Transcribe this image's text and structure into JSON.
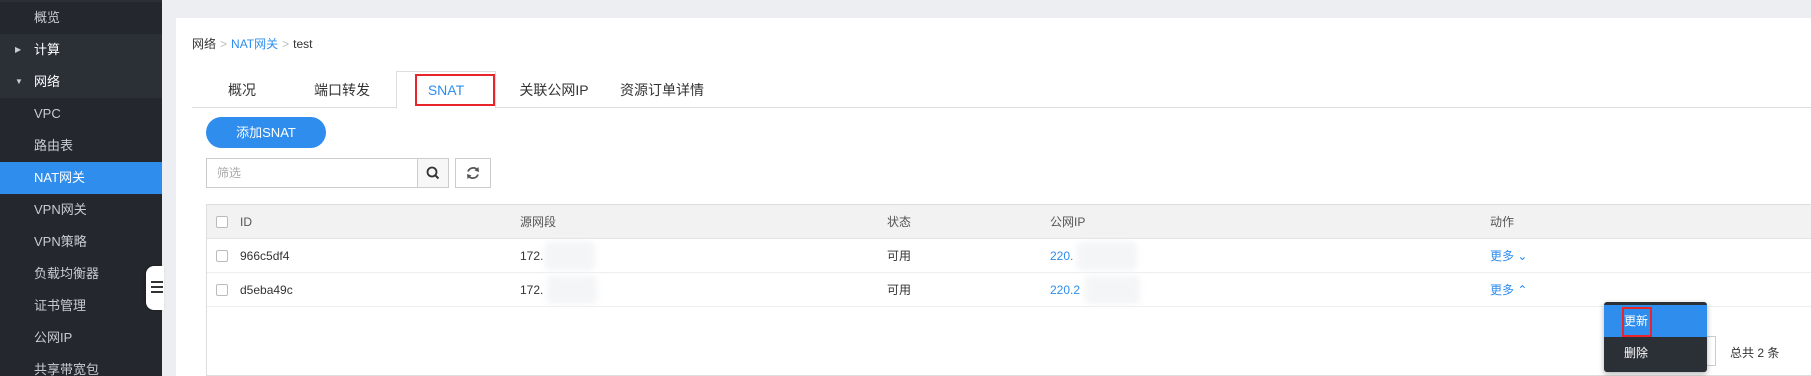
{
  "sidebar": {
    "items": [
      {
        "label": "概览"
      },
      {
        "label": "计算"
      },
      {
        "label": "网络"
      },
      {
        "label": "VPC"
      },
      {
        "label": "路由表"
      },
      {
        "label": "NAT网关"
      },
      {
        "label": "VPN网关"
      },
      {
        "label": "VPN策略"
      },
      {
        "label": "负载均衡器"
      },
      {
        "label": "证书管理"
      },
      {
        "label": "公网IP"
      },
      {
        "label": "共享带宽包"
      }
    ],
    "active": "NAT网关"
  },
  "breadcrumb": {
    "root": "网络",
    "sep1": ">",
    "parent": "NAT网关",
    "sep2": ">",
    "current": "test"
  },
  "tabs": [
    {
      "label": "概况"
    },
    {
      "label": "端口转发"
    },
    {
      "label": "SNAT"
    },
    {
      "label": "关联公网IP"
    },
    {
      "label": "资源订单详情"
    }
  ],
  "active_tab": "SNAT",
  "toolbar": {
    "add_label": "添加SNAT",
    "filter_placeholder": "筛选"
  },
  "table": {
    "columns": {
      "id": "ID",
      "source": "源网段",
      "status": "状态",
      "public_ip": "公网IP",
      "action": "动作"
    },
    "rows": [
      {
        "id": "966c5df4",
        "source": "172.",
        "status": "可用",
        "public_ip": "220.",
        "action": "更多 ⌄"
      },
      {
        "id": "d5eba49c",
        "source": "172.",
        "status": "可用",
        "public_ip": "220.2",
        "action": "更多 ⌃"
      }
    ]
  },
  "action_menu": {
    "items": [
      {
        "label": "更新"
      },
      {
        "label": "删除"
      }
    ]
  },
  "pagination": {
    "total": "总共 2 条"
  },
  "colors": {
    "accent": "#2e8ded",
    "highlight": "#e8252a",
    "sidebar_bg": "#2b2f36"
  }
}
